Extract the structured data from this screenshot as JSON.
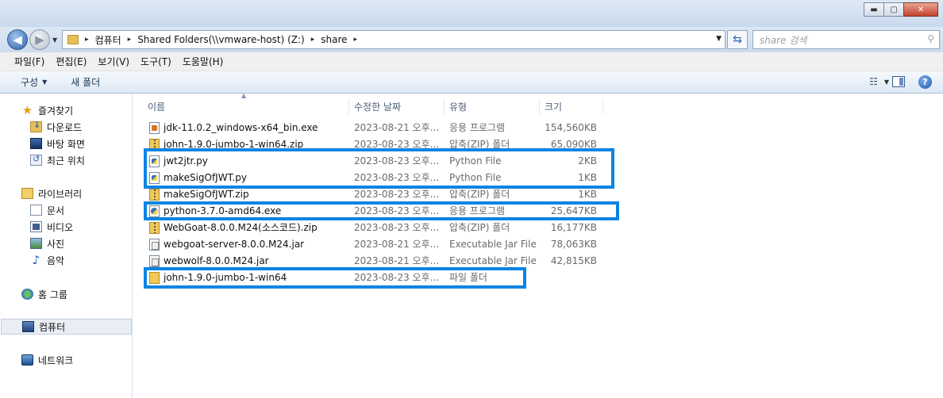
{
  "window": {
    "ghost_title_texts": [
      "",
      "",
      ""
    ],
    "minimize_glyph": "▬",
    "maximize_glyph": "▢",
    "close_glyph": "✕"
  },
  "address_bar": {
    "back_glyph": "◀",
    "forward_glyph": "▶",
    "crumbs": [
      "컴퓨터",
      "Shared Folders(\\\\vmware-host) (Z:)",
      "share"
    ],
    "separator": "▸",
    "dropdown_glyph": "▼",
    "refresh_glyph": "⇆",
    "search_placeholder": "share 검색",
    "search_glyph": "⚲"
  },
  "menu": {
    "items": [
      "파일(F)",
      "편집(E)",
      "보기(V)",
      "도구(T)",
      "도움말(H)"
    ]
  },
  "commandbar": {
    "organize_label": "구성",
    "new_folder_label": "새 폴더",
    "dropdown_glyph": "▼",
    "view_glyph": "☷",
    "help_glyph": "?"
  },
  "navpane": {
    "favorites": "즐겨찾기",
    "downloads": "다운로드",
    "desktop": "바탕 화면",
    "recent": "최근 위치",
    "libraries": "라이브러리",
    "documents": "문서",
    "videos": "비디오",
    "pictures": "사진",
    "music": "음악",
    "homegroup": "홈 그룹",
    "computer": "컴퓨터",
    "network": "네트워크",
    "star_glyph": "★",
    "note_glyph": "♪"
  },
  "filelist": {
    "sort_glyph": "▲",
    "columns": {
      "name": "이름",
      "date": "수정한 날짜",
      "type": "유형",
      "size": "크기"
    },
    "rows": [
      {
        "name": "jdk-11.0.2_windows-x64_bin.exe",
        "date": "2023-08-21 오후...",
        "type": "응용 프로그램",
        "size": "154,560KB",
        "icon": "exe"
      },
      {
        "name": "john-1.9.0-jumbo-1-win64.zip",
        "date": "2023-08-23 오후...",
        "type": "압축(ZIP) 폴더",
        "size": "65,090KB",
        "icon": "zip"
      },
      {
        "name": "jwt2jtr.py",
        "date": "2023-08-23 오후...",
        "type": "Python File",
        "size": "2KB",
        "icon": "py"
      },
      {
        "name": "makeSigOfJWT.py",
        "date": "2023-08-23 오후...",
        "type": "Python File",
        "size": "1KB",
        "icon": "py"
      },
      {
        "name": "makeSigOfJWT.zip",
        "date": "2023-08-23 오후...",
        "type": "압축(ZIP) 폴더",
        "size": "1KB",
        "icon": "zip"
      },
      {
        "name": "python-3.7.0-amd64.exe",
        "date": "2023-08-23 오후...",
        "type": "응용 프로그램",
        "size": "25,647KB",
        "icon": "inst"
      },
      {
        "name": "WebGoat-8.0.0.M24(소스코드).zip",
        "date": "2023-08-23 오후...",
        "type": "압축(ZIP) 폴더",
        "size": "16,177KB",
        "icon": "zip"
      },
      {
        "name": "webgoat-server-8.0.0.M24.jar",
        "date": "2023-08-21 오후...",
        "type": "Executable Jar File",
        "size": "78,063KB",
        "icon": "jar"
      },
      {
        "name": "webwolf-8.0.0.M24.jar",
        "date": "2023-08-21 오후...",
        "type": "Executable Jar File",
        "size": "42,815KB",
        "icon": "jar"
      },
      {
        "name": "john-1.9.0-jumbo-1-win64",
        "date": "2023-08-23 오후...",
        "type": "파일 폴더",
        "size": "",
        "icon": "folder"
      }
    ]
  },
  "colors": {
    "highlight": "#0a84e3"
  }
}
